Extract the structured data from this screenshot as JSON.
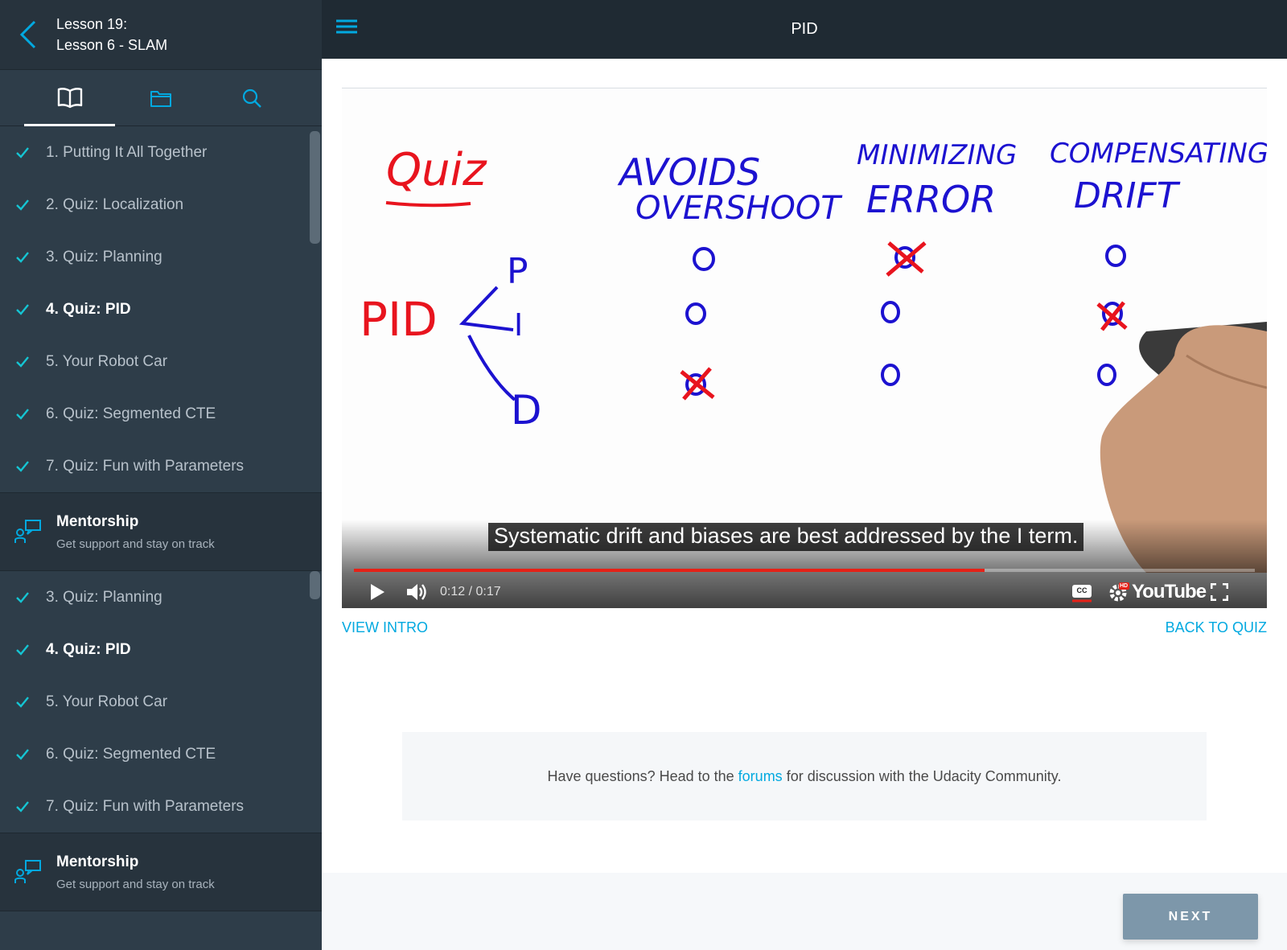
{
  "sidebar": {
    "lesson_line1": "Lesson 19:",
    "lesson_line2": "Lesson 6 - SLAM",
    "tabs": [
      "book-icon",
      "folder-icon",
      "search-icon"
    ],
    "concepts_a": [
      {
        "label": "1. Putting It All Together",
        "current": false
      },
      {
        "label": "2. Quiz: Localization",
        "current": false
      },
      {
        "label": "3. Quiz: Planning",
        "current": false
      },
      {
        "label": "4. Quiz: PID",
        "current": true
      },
      {
        "label": "5. Your Robot Car",
        "current": false
      },
      {
        "label": "6. Quiz: Segmented CTE",
        "current": false
      },
      {
        "label": "7. Quiz: Fun with Parameters",
        "current": false
      }
    ],
    "concepts_b": [
      {
        "label": "3. Quiz: Planning",
        "current": false
      },
      {
        "label": "4. Quiz: PID",
        "current": true
      },
      {
        "label": "5. Your Robot Car",
        "current": false
      },
      {
        "label": "6. Quiz: Segmented CTE",
        "current": false
      },
      {
        "label": "7. Quiz: Fun with Parameters",
        "current": false
      }
    ],
    "mentorship": {
      "title": "Mentorship",
      "subtitle": "Get support and stay on track"
    }
  },
  "header": {
    "title": "PID"
  },
  "video": {
    "caption": "Systematic drift and biases are best addressed by the I term.",
    "time": "0:12 / 0:17",
    "progress": 0.7,
    "youtube_label": "YouTube",
    "hd_badge": "HD",
    "cc_label": "CC",
    "whiteboard": {
      "quiz": "Quiz",
      "pid": "PID",
      "terms": [
        "P",
        "I",
        "D"
      ],
      "col1": [
        "AVOIDS",
        "OVERSHOOT"
      ],
      "col2": [
        "MINIMIZING",
        "ERROR"
      ],
      "col3": [
        "COMPENSATING",
        "DRIFT"
      ]
    }
  },
  "links": {
    "view_intro": "VIEW INTRO",
    "back_to_quiz": "BACK TO QUIZ"
  },
  "forum": {
    "before": "Have questions? Head to the",
    "link": "forums",
    "after": "for discussion with the Udacity Community."
  },
  "footer": {
    "next": "NEXT"
  },
  "colors": {
    "accent": "#02a9e0",
    "check": "#15c5d3",
    "sidebar": "#2e3d49",
    "progress": "#e62117"
  }
}
